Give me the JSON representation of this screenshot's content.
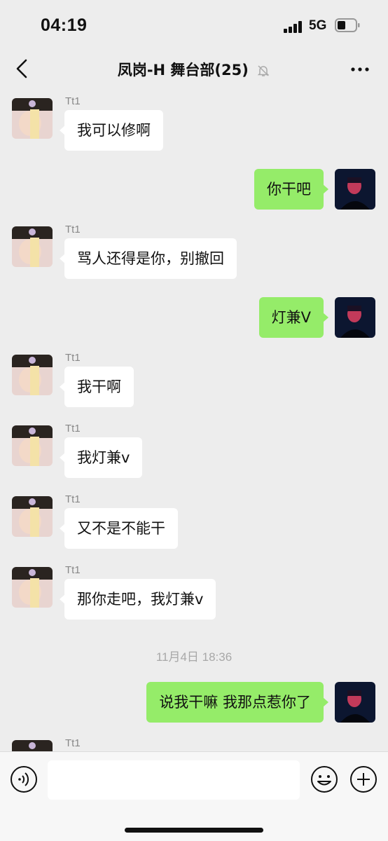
{
  "status_bar": {
    "time": "04:19",
    "network": "5G"
  },
  "header": {
    "title": "凤岗-H 舞台部(25)"
  },
  "messages": [
    {
      "side": "in",
      "sender": "Tt1",
      "text": "我可以修啊"
    },
    {
      "side": "out",
      "text": "你干吧"
    },
    {
      "side": "in",
      "sender": "Tt1",
      "text": "骂人还得是你，别撤回"
    },
    {
      "side": "out",
      "text": "灯兼V"
    },
    {
      "side": "in",
      "sender": "Tt1",
      "text": "我干啊"
    },
    {
      "side": "in",
      "sender": "Tt1",
      "text": "我灯兼v"
    },
    {
      "side": "in",
      "sender": "Tt1",
      "text": "又不是不能干"
    },
    {
      "side": "in",
      "sender": "Tt1",
      "text": "那你走吧，我灯兼v"
    },
    {
      "side": "out",
      "text": "说我干嘛 我那点惹你了"
    },
    {
      "side": "in",
      "sender": "Tt1",
      "text": ""
    }
  ],
  "timestamp": "11月4日 18:36",
  "input": {
    "value": ""
  },
  "colors": {
    "background": "#ededed",
    "outgoing_bubble": "#95ec69",
    "incoming_bubble": "#ffffff",
    "timestamp_text": "#a8a8a8"
  },
  "icons": [
    "back-chevron-icon",
    "mute-bell-icon",
    "more-dots-icon",
    "voice-icon",
    "emoji-icon",
    "plus-icon"
  ]
}
